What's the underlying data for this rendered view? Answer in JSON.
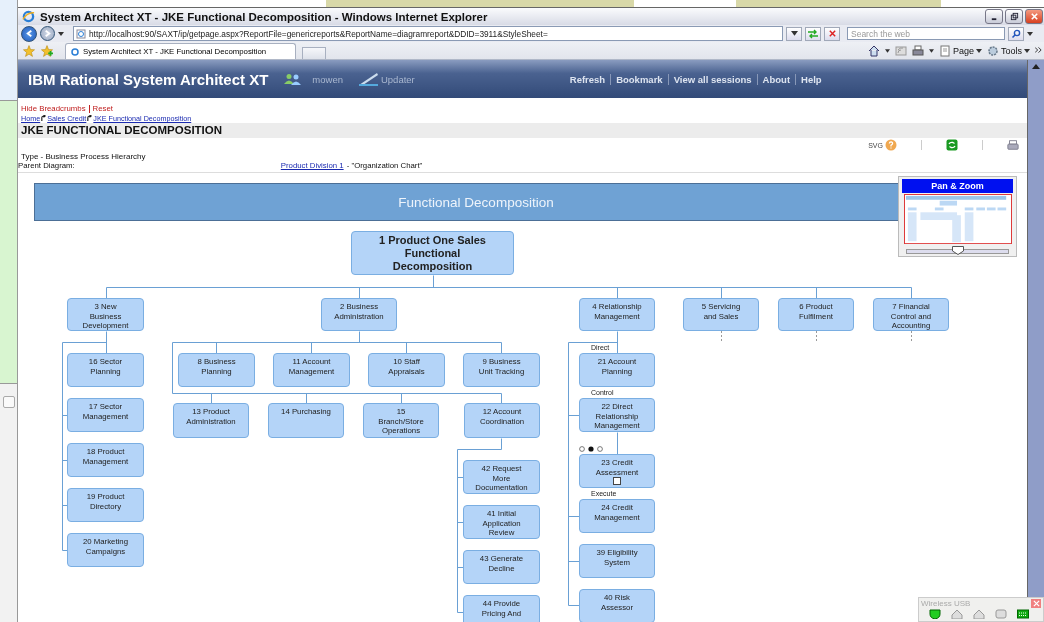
{
  "browser": {
    "title": "System Architect XT - JKE Functional Decomposition - Windows Internet Explorer",
    "url": "http://localhost:90/SAXT/ip/getpage.aspx?ReportFile=genericreports&ReportName=diagramreport&DDID=3911&StyleSheet=",
    "search": {
      "placeholder": "Search the web"
    },
    "tab": {
      "label": "System Architect XT - JKE Functional Decomposition"
    },
    "tools": [
      "Page",
      "Tools"
    ]
  },
  "app": {
    "title": "IBM Rational System Architect XT",
    "user": "mowen",
    "updater": "Updater",
    "nav": [
      "Refresh",
      "Bookmark",
      "View all sessions",
      "About",
      "Help"
    ]
  },
  "breadcrumb_actions": [
    "Hide Breadcrumbs",
    "Reset"
  ],
  "breadcrumbs": [
    "Home",
    "Sales Credit",
    "JKE Functional Decomposition"
  ],
  "page_title": "JKE FUNCTIONAL DECOMPOSITION",
  "svg_label": "SVG",
  "type_line": "Type - Business Process Hierarchy",
  "parent": {
    "label": "Parent Diagram:",
    "link": "Product Division 1",
    "suffix": "- \"Organization Chart\""
  },
  "diagram": {
    "banner": "Functional Decomposition",
    "root": {
      "label": "1 Product One Sales\nFunctional\nDecomposition",
      "children": [
        {
          "label": "3 New\nBusiness\nDevelopment",
          "children": [
            {
              "label": "16 Sector\nPlanning"
            },
            {
              "label": "17 Sector\nManagement"
            },
            {
              "label": "18 Product\nManagement"
            },
            {
              "label": "19 Product\nDirectory"
            },
            {
              "label": "20 Marketing\nCampaigns"
            }
          ]
        },
        {
          "label": "2 Business\nAdministration",
          "children": [
            {
              "label": "8 Business\nPlanning"
            },
            {
              "label": "11 Account\nManagement"
            },
            {
              "label": "10 Staff\nAppraisals"
            },
            {
              "label": "9 Business\nUnit Tracking"
            },
            {
              "label": "13 Product\nAdministration"
            },
            {
              "label": "14 Purchasing"
            },
            {
              "label": "15\nBranch/Store\nOperations"
            },
            {
              "label": "12 Account\nCoordination",
              "children": [
                {
                  "label": "42 Request\nMore\nDocumentation"
                },
                {
                  "label": "41 Initial\nApplication\nReview"
                },
                {
                  "label": "43 Generate\nDecline"
                },
                {
                  "label": "44 Provide\nPricing And"
                }
              ]
            }
          ]
        },
        {
          "label": "4 Relationship\nManagement",
          "children": [
            {
              "label": "21 Account\nPlanning",
              "link_label": "Direct"
            },
            {
              "label": "22 Direct\nRelationship\nManagement",
              "link_label": "Control"
            },
            {
              "label": "23 Credit\nAssessment"
            },
            {
              "label": "24 Credit\nManagement",
              "link_label": "Execute"
            },
            {
              "label": "39 Eligibility\nSystem"
            },
            {
              "label": "40 Risk\nAssessor"
            }
          ]
        },
        {
          "label": "5 Servicing\nand Sales"
        },
        {
          "label": "6 Product\nFulfilment"
        },
        {
          "label": "7 Financial\nControl and\nAccounting"
        }
      ]
    }
  },
  "pan_zoom": {
    "title": "Pan & Zoom",
    "level": 0.5
  },
  "tray": {
    "title": "Wireless USB"
  }
}
